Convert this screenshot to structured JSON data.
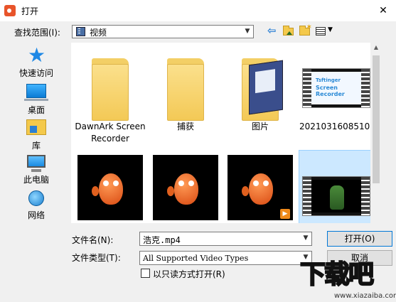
{
  "window": {
    "title": "打开"
  },
  "lookin": {
    "label": "查找范围(I):",
    "value": "视频"
  },
  "nav": [
    {
      "label": "快速访问",
      "icon": "star-icon"
    },
    {
      "label": "桌面",
      "icon": "desktop-icon"
    },
    {
      "label": "库",
      "icon": "library-icon"
    },
    {
      "label": "此电脑",
      "icon": "computer-icon"
    },
    {
      "label": "网络",
      "icon": "network-icon"
    }
  ],
  "files": [
    {
      "name": "DawnArk Screen Recorder",
      "kind": "folder"
    },
    {
      "name": "捕获",
      "kind": "folder"
    },
    {
      "name": "图片",
      "kind": "folder"
    },
    {
      "name": "2021031608510...",
      "kind": "video",
      "thumb_line1": "Tsftinger",
      "thumb_line2": "Screen Recorder"
    },
    {
      "name": "",
      "kind": "video"
    },
    {
      "name": "",
      "kind": "video"
    },
    {
      "name": "",
      "kind": "video"
    },
    {
      "name": "",
      "kind": "video",
      "selected": true
    }
  ],
  "filename": {
    "label": "文件名(N):",
    "value": "浩克.mp4"
  },
  "filetype": {
    "label": "文件类型(T):",
    "value": "All Supported Video Types"
  },
  "buttons": {
    "open": "打开(O)",
    "cancel": "取消"
  },
  "readonly": {
    "label": "以只读方式打开(R)"
  },
  "watermark": {
    "text": "下载吧",
    "url": "www.xiazaiba.com"
  },
  "colors": {
    "selection": "#cce8ff",
    "accent": "#0078d7",
    "folder": "#f3c956"
  }
}
